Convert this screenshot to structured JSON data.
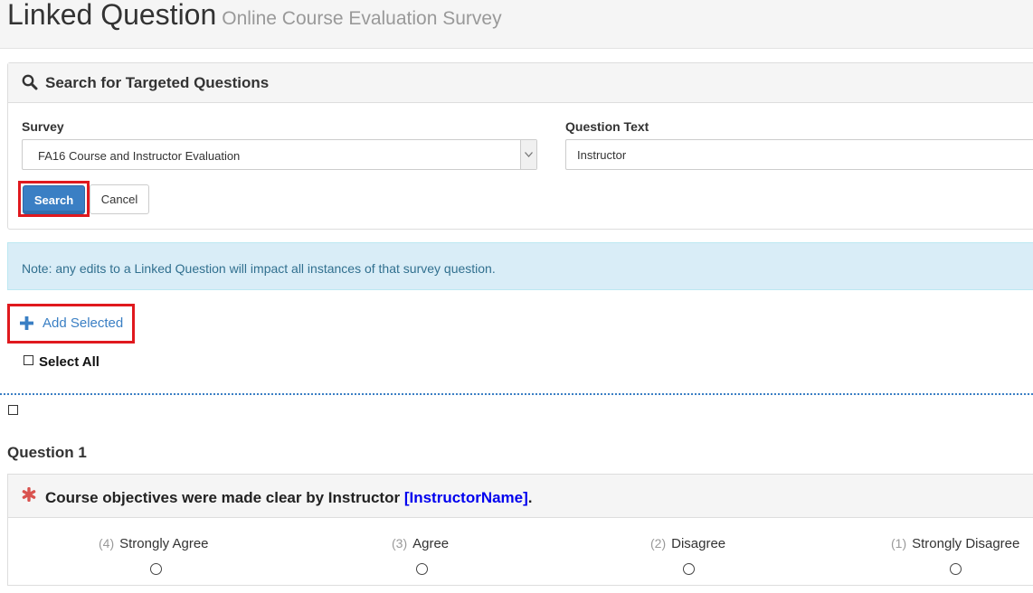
{
  "header": {
    "title": "Linked Question",
    "subtitle": "Online Course Evaluation Survey"
  },
  "search_panel": {
    "heading": "Search for Targeted Questions",
    "survey_label": "Survey",
    "survey_selected": "FA16 Course and Instructor Evaluation",
    "question_text_label": "Question Text",
    "question_text_value": "Instructor",
    "search_button": "Search",
    "cancel_button": "Cancel"
  },
  "note": "Note: any edits to a Linked Question will impact all instances of that survey question.",
  "actions": {
    "add_selected": "Add Selected",
    "select_all": "Select All"
  },
  "question": {
    "label": "Question 1",
    "text": "Course objectives were made clear by Instructor ",
    "piped_text": "[InstructorName]",
    "text_end": ".",
    "options": [
      {
        "num": "(4)",
        "label": "Strongly Agree"
      },
      {
        "num": "(3)",
        "label": "Agree"
      },
      {
        "num": "(2)",
        "label": "Disagree"
      },
      {
        "num": "(1)",
        "label": "Strongly Disagree"
      }
    ]
  },
  "colors": {
    "primary": "#3a7fc4",
    "highlight": "#e0191e",
    "required": "#d9534f",
    "piped": "#0000ee",
    "note_bg": "#d9edf7"
  }
}
